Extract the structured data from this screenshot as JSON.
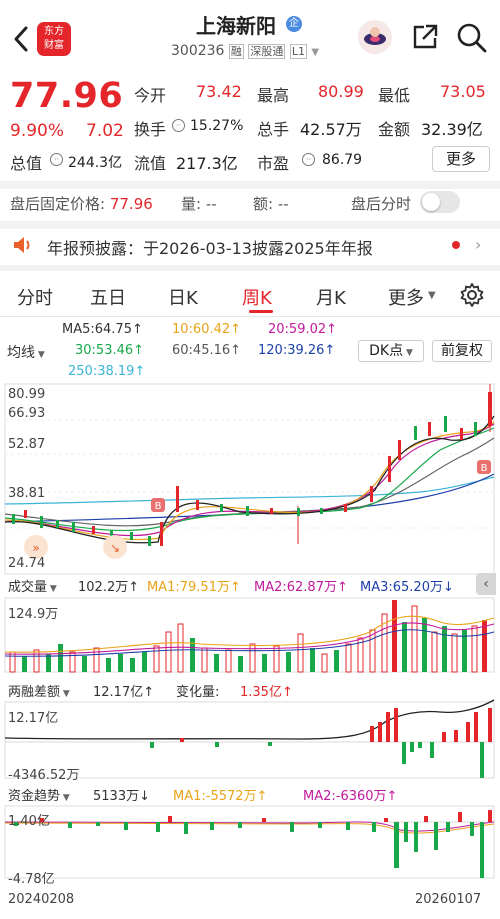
{
  "header": {
    "logo_line1": "东方",
    "logo_line2": "财富",
    "title": "上海新阳",
    "title_badge": "企",
    "code": "300236",
    "tag_margin": "融",
    "tag_connect": "深股通",
    "tag_level": "L1"
  },
  "quote": {
    "price": "77.96",
    "change_pct": "9.90%",
    "change": "7.02",
    "stats": [
      {
        "label": "今开",
        "value": "73.42"
      },
      {
        "label": "最高",
        "value": "80.99"
      },
      {
        "label": "最低",
        "value": "73.05"
      },
      {
        "label": "换手",
        "value": "15.27%"
      },
      {
        "label": "总手",
        "value": "42.57万"
      },
      {
        "label": "金额",
        "value": "32.39亿"
      },
      {
        "label": "总值",
        "value": "244.3亿"
      },
      {
        "label": "流值",
        "value": "217.3亿"
      },
      {
        "label": "市盈",
        "value": "86.79"
      }
    ],
    "more_button": "更多"
  },
  "after_hours": {
    "fixed_price_label": "盘后固定价格:",
    "fixed_price": "77.96",
    "volume_label": "量:",
    "volume": "--",
    "amount_label": "额:",
    "amount": "--",
    "intraday_label": "盘后分时"
  },
  "notice": {
    "text": "年报预披露：于2026-03-13披露2025年年报"
  },
  "tabs": [
    "分时",
    "五日",
    "日K",
    "周K",
    "月K",
    "更多"
  ],
  "ma": {
    "selector": "均线",
    "ma5": "MA5:64.75↑",
    "ma10": "10:60.42↑",
    "ma20": "20:59.02↑",
    "ma30": "30:53.46↑",
    "ma60": "60:45.16↑",
    "ma120": "120:39.26↑",
    "ma250": "250:38.19↑",
    "dk_button": "DK点",
    "adjust_button": "前复权"
  },
  "kline_axis": {
    "high": "80.99",
    "t1": "66.93",
    "t2": "52.87",
    "t3": "38.81",
    "low": "24.74"
  },
  "volume_panel": {
    "label": "成交量",
    "value": "102.2万↑",
    "ma1": "MA1:79.51万↑",
    "ma2": "MA2:62.87万↑",
    "ma3": "MA3:65.20万↓",
    "axis_top": "124.9万"
  },
  "margin_panel": {
    "label": "两融差额",
    "value": "12.17亿↑",
    "change_label": "变化量:",
    "change_value": "1.35亿↑",
    "axis_top": "12.17亿",
    "axis_bottom": "-4346.52万"
  },
  "flow_panel": {
    "label": "资金趋势",
    "value": "5133万↓",
    "ma1": "MA1:-5572万↑",
    "ma2": "MA2:-6360万↑",
    "axis_top": "1.40亿",
    "axis_bottom": "-4.78亿"
  },
  "dates": {
    "start": "20240208",
    "end": "20260107"
  },
  "colors": {
    "up": "#e4262a",
    "down": "#18a84a",
    "brand": "#e4262a"
  }
}
